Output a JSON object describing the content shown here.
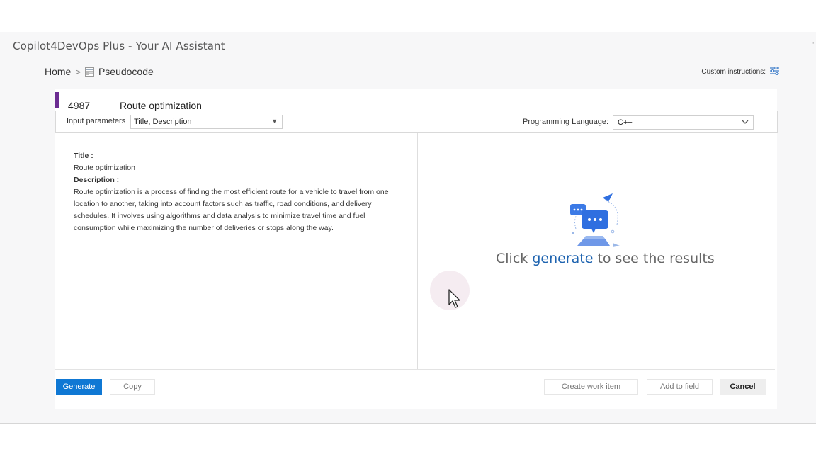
{
  "app": {
    "title": "Copilot4DevOps Plus - Your AI Assistant",
    "corner_glyph": "·"
  },
  "breadcrumb": {
    "home": "Home",
    "separator": ">",
    "current": "Pseudocode",
    "current_icon": "document-icon"
  },
  "custom_instructions": {
    "label": "Custom instructions:",
    "icon": "sliders-icon"
  },
  "work_item": {
    "id": "4987",
    "title": "Route optimization",
    "accent_color": "#6b2c91"
  },
  "params": {
    "input_label": "Input parameters",
    "input_value": "Title, Description",
    "language_label": "Programming Language:",
    "language_value": "C++"
  },
  "content": {
    "title_label": "Title :",
    "title_value": "Route optimization",
    "description_label": "Description :",
    "description_value": "Route optimization is a process of finding the most efficient route for a vehicle to travel from one location to another, taking into account factors such as traffic, road conditions, and delivery schedules. It involves using algorithms and data analysis to minimize travel time and fuel consumption while maximizing the number of deliveries or stops along the way."
  },
  "results": {
    "hint_prefix": "Click ",
    "hint_link": "generate",
    "hint_suffix": " to see the results",
    "illustration_icon": "chat-bubbles-icon"
  },
  "footer": {
    "generate": "Generate",
    "copy": "Copy",
    "create_work_item": "Create work item",
    "add_to_field": "Add to field",
    "cancel": "Cancel"
  },
  "colors": {
    "primary": "#0f78d4",
    "link": "#1f64b0",
    "accent": "#6b2c91"
  }
}
